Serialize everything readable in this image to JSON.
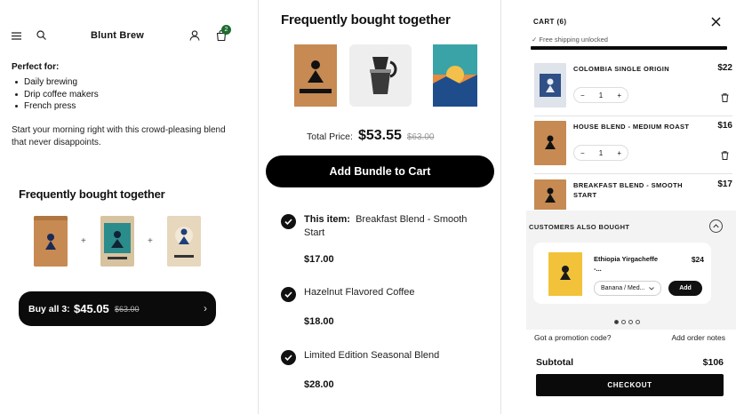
{
  "header": {
    "brand": "Blunt Brew",
    "cart_count": "2"
  },
  "product": {
    "perfect_for_heading": "Perfect for:",
    "perfect_for": [
      "Daily brewing",
      "Drip coffee makers",
      "French press"
    ],
    "description": "Start your morning right with this crowd-pleasing blend that never disappoints."
  },
  "bundle_left": {
    "heading": "Frequently bought together",
    "plus": "+",
    "buy_label": "Buy all 3:",
    "price": "$45.05",
    "old_price": "$63.00",
    "chevron": "›"
  },
  "bundle_mid": {
    "heading": "Frequently bought together",
    "total_label": "Total Price:",
    "total": "$53.55",
    "old_total": "$63.00",
    "add_button": "Add Bundle to Cart",
    "items": [
      {
        "prefix": "This item:",
        "name": "Breakfast Blend - Smooth Start",
        "price": "$17.00"
      },
      {
        "prefix": "",
        "name": "Hazelnut Flavored Coffee",
        "price": "$18.00"
      },
      {
        "prefix": "",
        "name": "Limited Edition Seasonal Blend",
        "price": "$28.00"
      }
    ]
  },
  "cart": {
    "title": "CART (6)",
    "shipping": "✓ Free shipping unlocked",
    "shipping_progress": 1.0,
    "items": [
      {
        "name": "COLOMBIA SINGLE ORIGIN",
        "price": "$22",
        "qty": "1"
      },
      {
        "name": "HOUSE BLEND - MEDIUM ROAST",
        "price": "$16",
        "qty": "1"
      },
      {
        "name": "BREAKFAST BLEND - SMOOTH START",
        "price": "$17",
        "qty": ""
      }
    ],
    "minus": "−",
    "plus": "+",
    "also_heading": "CUSTOMERS ALSO BOUGHT",
    "recommendation": {
      "name": "Ethiopia Yirgacheffe -...",
      "price": "$24",
      "variant": "Banana / Med...",
      "add": "Add"
    },
    "promo": "Got a promotion code?",
    "notes": "Add order notes",
    "subtotal_label": "Subtotal",
    "subtotal": "$106",
    "checkout": "CHECKOUT"
  },
  "colors": {
    "accent": "#0b0b0b",
    "badge": "#1d6b2f",
    "kraft": "#c9935b",
    "teal": "#2b8c8c",
    "blue": "#1e3f7a"
  }
}
